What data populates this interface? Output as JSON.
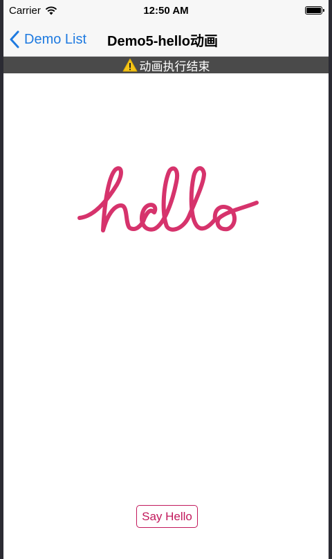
{
  "status_bar": {
    "carrier": "Carrier",
    "time": "12:50 AM",
    "wifi_icon": "wifi-icon",
    "battery_icon": "battery-icon"
  },
  "nav": {
    "back_label": "Demo List",
    "back_icon": "chevron-left-icon",
    "title": "Demo5-hello动画",
    "accent_color": "#1e7ae0"
  },
  "banner": {
    "icon": "warning-icon",
    "text": "动画执行结束",
    "background": "#4a4a4a"
  },
  "canvas": {
    "art": "hello",
    "stroke_color": "#d6336c"
  },
  "button": {
    "label": "Say Hello",
    "color": "#c2185b"
  }
}
